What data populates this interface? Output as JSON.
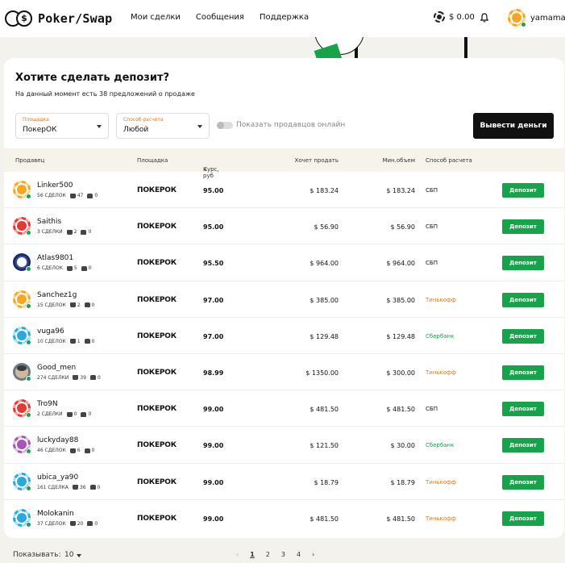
{
  "header": {
    "brand": "Poker/Swap",
    "logo_glyph": "$",
    "nav": [
      "Мои сделки",
      "Сообщения",
      "Поддержка"
    ],
    "balance": "$ 0.00",
    "username": "yamamai"
  },
  "card": {
    "title": "Хотите сделать депозит?",
    "subtitle": "На данный момент есть 38 предложений о продаже",
    "filters": {
      "site_label": "Площадка",
      "site_value": "ПокерОК",
      "pay_label": "Способ расчета",
      "pay_value": "Любой"
    },
    "toggle_label": "Показать продавцов онлайн",
    "withdraw_label": "Вывести деньги"
  },
  "table": {
    "headers": {
      "seller": "Продавец",
      "site": "Площадка",
      "rate": "Курс, руб",
      "want": "Хочет продать",
      "min": "Мин.объем",
      "pay": "Способ расчета"
    },
    "deposit_label": "Депозит",
    "rows": [
      {
        "name": "Linker500",
        "deals": "56 СДЕЛОК",
        "likes": "47",
        "dislikes": "0",
        "site": "ПОКЕРОК",
        "rate": "95.00",
        "want": "$ 183.24",
        "min": "$ 183.24",
        "pay": "СБП",
        "pay_kind": "sbp",
        "avatar": "orange"
      },
      {
        "name": "Saithis",
        "deals": "3 СДЕЛКИ",
        "likes": "2",
        "dislikes": "0",
        "site": "ПОКЕРОК",
        "rate": "95.00",
        "want": "$ 56.90",
        "min": "$ 56.90",
        "pay": "СБП",
        "pay_kind": "sbp",
        "avatar": "red"
      },
      {
        "name": "Atlas9801",
        "deals": "6 СДЕЛОК",
        "likes": "5",
        "dislikes": "0",
        "site": "ПОКЕРОК",
        "rate": "95.50",
        "want": "$ 964.00",
        "min": "$ 964.00",
        "pay": "СБП",
        "pay_kind": "sbp",
        "avatar": "navy"
      },
      {
        "name": "Sanchez1g",
        "deals": "15 СДЕЛОК",
        "likes": "2",
        "dislikes": "0",
        "site": "ПОКЕРОК",
        "rate": "97.00",
        "want": "$ 385.00",
        "min": "$ 385.00",
        "pay": "Тинькофф",
        "pay_kind": "tink",
        "avatar": "orange"
      },
      {
        "name": "vuga96",
        "deals": "10 СДЕЛОК",
        "likes": "1",
        "dislikes": "0",
        "site": "ПОКЕРОК",
        "rate": "97.00",
        "want": "$ 129.48",
        "min": "$ 129.48",
        "pay": "Сбербанк",
        "pay_kind": "sber",
        "avatar": "blue"
      },
      {
        "name": "Good_men",
        "deals": "274 СДЕЛКИ",
        "likes": "39",
        "dislikes": "0",
        "site": "ПОКЕРОК",
        "rate": "98.99",
        "want": "$ 1350.00",
        "min": "$ 300.00",
        "pay": "Тинькофф",
        "pay_kind": "tink",
        "avatar": "photo"
      },
      {
        "name": "Tro9N",
        "deals": "2 СДЕЛКИ",
        "likes": "0",
        "dislikes": "0",
        "site": "ПОКЕРОК",
        "rate": "99.00",
        "want": "$ 481.50",
        "min": "$ 481.50",
        "pay": "СБП",
        "pay_kind": "sbp",
        "avatar": "red"
      },
      {
        "name": "luckyday88",
        "deals": "46 СДЕЛОК",
        "likes": "6",
        "dislikes": "0",
        "site": "ПОКЕРОК",
        "rate": "99.00",
        "want": "$ 121.50",
        "min": "$ 30.00",
        "pay": "Сбербанк",
        "pay_kind": "sber",
        "avatar": "purple"
      },
      {
        "name": "ubica_ya90",
        "deals": "161 СДЕЛКА",
        "likes": "36",
        "dislikes": "0",
        "site": "ПОКЕРОК",
        "rate": "99.00",
        "want": "$ 18.79",
        "min": "$ 18.79",
        "pay": "Тинькофф",
        "pay_kind": "tink",
        "avatar": "blue"
      },
      {
        "name": "Molokanin",
        "deals": "37 СДЕЛОК",
        "likes": "20",
        "dislikes": "0",
        "site": "ПОКЕРОК",
        "rate": "99.00",
        "want": "$ 481.50",
        "min": "$ 481.50",
        "pay": "Тинькофф",
        "pay_kind": "tink",
        "avatar": "blue"
      }
    ]
  },
  "footer": {
    "show_label": "Показывать:",
    "show_value": "10",
    "pages": [
      "1",
      "2",
      "3",
      "4"
    ],
    "prev": "‹",
    "next": "›",
    "sort_arrow": "↓"
  }
}
